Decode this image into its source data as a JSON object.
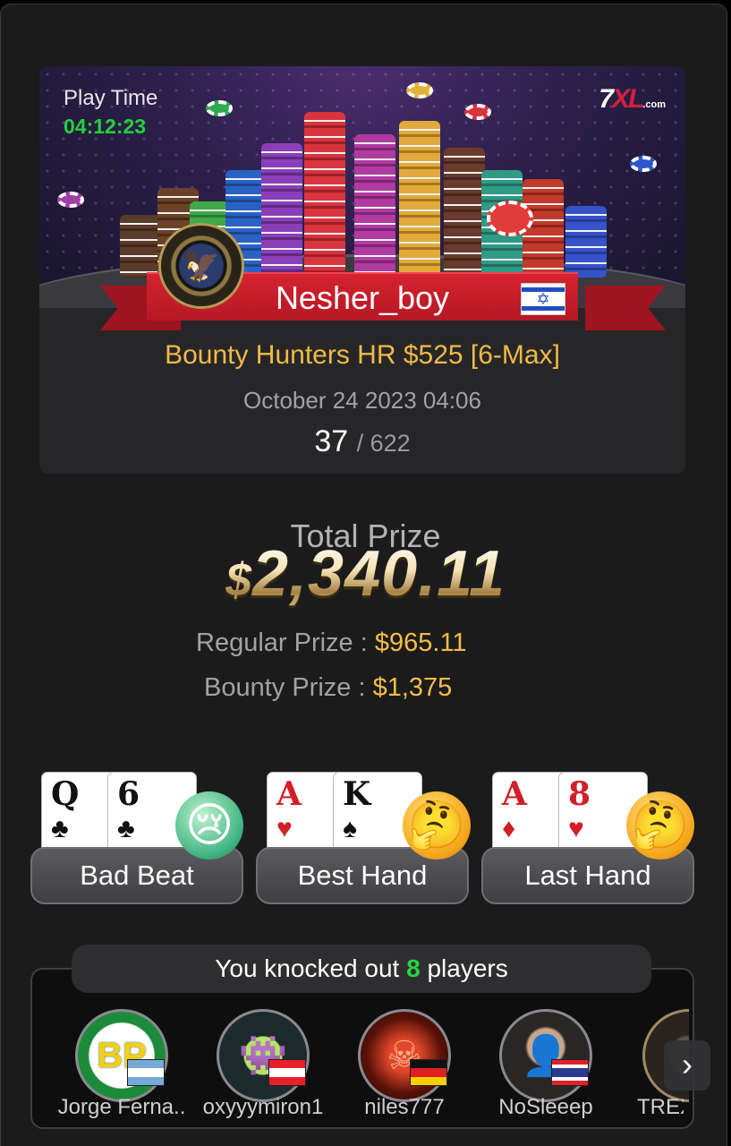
{
  "header": {
    "play_time_label": "Play Time",
    "play_time": "04:12:23",
    "brand": {
      "main": "7",
      "x": "XL",
      "suffix": ".com"
    },
    "player_name": "Nesher_boy",
    "player_flag_glyph": "✡",
    "tournament": "Bounty Hunters HR $525 [6-Max]",
    "date": "October 24 2023 04:06",
    "rank": "37",
    "rank_of": "/ 622"
  },
  "prize": {
    "total_label": "Total Prize",
    "currency": "$",
    "total_amount": "2,340.11",
    "regular_label": "Regular Prize :",
    "regular_value": "$965.11",
    "bounty_label": "Bounty Prize :",
    "bounty_value": "$1,375"
  },
  "hands": [
    {
      "label": "Bad Beat",
      "cards": [
        {
          "rank": "Q",
          "suit": "♣"
        },
        {
          "rank": "6",
          "suit": "♣"
        }
      ],
      "emoji": "😢"
    },
    {
      "label": "Best Hand",
      "cards": [
        {
          "rank": "A",
          "suit": "♥"
        },
        {
          "rank": "K",
          "suit": "♠"
        }
      ],
      "emoji": "🤔"
    },
    {
      "label": "Last Hand",
      "cards": [
        {
          "rank": "A",
          "suit": "♦"
        },
        {
          "rank": "8",
          "suit": "♥"
        }
      ],
      "emoji": "🤔"
    }
  ],
  "knockouts": {
    "prefix": "You knocked out",
    "count": "8",
    "suffix": "players",
    "players": [
      {
        "name": "Jorge Ferna..",
        "avatar_text": "BP",
        "flag": "argentina"
      },
      {
        "name": "oxyyymiron1",
        "avatar_text": "👾",
        "flag": "austria"
      },
      {
        "name": "niles777",
        "avatar_text": "☠",
        "flag": "germany"
      },
      {
        "name": "NoSleeep",
        "avatar_text": "👤",
        "flag": "thailand"
      },
      {
        "name": "TREX",
        "avatar_text": "",
        "flag": ""
      }
    ],
    "next_glyph": "›"
  },
  "colors": {
    "accent_gold": "#f1b947",
    "play_time_green": "#22d13a",
    "ribbon_red": "#c81d2a",
    "count_green": "#28d241"
  }
}
